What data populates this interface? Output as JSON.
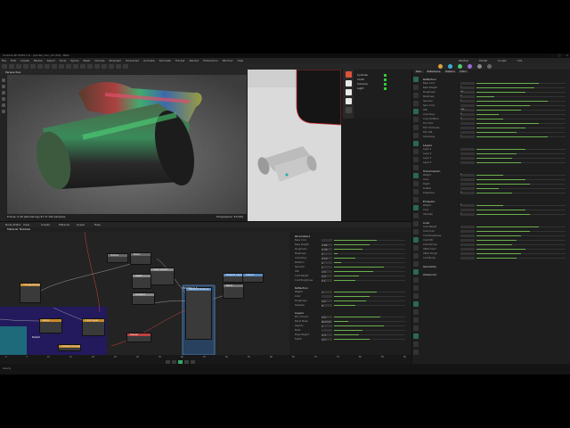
{
  "window": {
    "title": "Cinema 4D 2025.1.0 - [render_mix_v3.c4d] - Main"
  },
  "menubar": {
    "items": [
      "File",
      "Edit",
      "Create",
      "Modes",
      "Select",
      "Tools",
      "Spline",
      "Mesh",
      "Volume",
      "MoGraph",
      "Character",
      "Animate",
      "Simulate",
      "Tracker",
      "Render",
      "Extensions",
      "Window",
      "Help"
    ],
    "layout_tabs": [
      "Startup",
      "Model",
      "Sculpt",
      "UVs"
    ]
  },
  "viewport_main": {
    "header": "Perspective",
    "status_left": "Frame: 0 06 (Rendering) 97 of 100 samples",
    "status_right": "Progressive: 97/100"
  },
  "object_manager": {
    "rows": [
      "Cylinder",
      "Cloth",
      "Camera",
      "Light"
    ]
  },
  "node_editor": {
    "header_tabs": [
      "Node Editor",
      "View",
      "Create",
      "Material",
      "Graph",
      "Help"
    ],
    "tab": "Material: Bubbles",
    "nodes": [
      {
        "title": "Change Range"
      },
      {
        "title": "Texture"
      },
      {
        "title": "Noise"
      },
      {
        "title": "Color Correct"
      },
      {
        "title": "Invert"
      },
      {
        "title": "Material Layer"
      },
      {
        "title": "Output"
      },
      {
        "title": "Blend"
      },
      {
        "title": "Standard Material"
      },
      {
        "title": "Gradient"
      },
      {
        "title": "Color Layer"
      },
      {
        "title": "Ramp"
      },
      {
        "title": "Fresnel"
      },
      {
        "title": "Ambient Occlusion"
      }
    ],
    "frame_label": "MATERIALS",
    "material_label": "Standard Material",
    "area_label": "Detail"
  },
  "node_attributes": {
    "section1": "Parameters",
    "rows": [
      {
        "label": "Base Color",
        "val": "",
        "fill": 0.6
      },
      {
        "label": "Base Weight",
        "val": "0.82",
        "fill": 0.5
      },
      {
        "label": "Roughness",
        "val": "0.35",
        "fill": 0.4
      },
      {
        "label": "Metalness",
        "val": "0",
        "fill": 0.05
      },
      {
        "label": "Anisotropy",
        "val": "0.12",
        "fill": 0.3
      },
      {
        "label": "Rotation",
        "val": "0",
        "fill": 0.1
      },
      {
        "label": "Specular",
        "val": "1",
        "fill": 0.7
      },
      {
        "label": "IOR",
        "val": "1.5",
        "fill": 0.55
      },
      {
        "label": "Coat Weight",
        "val": "0.2",
        "fill": 0.35
      },
      {
        "label": "Coat Roughness",
        "val": "0.1",
        "fill": 0.3
      }
    ],
    "section2": "Reflection",
    "rows2": [
      {
        "label": "Weight",
        "val": "1",
        "fill": 0.6
      },
      {
        "label": "Color",
        "val": "",
        "fill": 0.5
      },
      {
        "label": "Roughness",
        "val": "0.2",
        "fill": 0.45
      },
      {
        "label": "Samples",
        "val": "8",
        "fill": 0.3
      }
    ],
    "section3": "Layers",
    "rows3": [
      {
        "label": "Mix Amount",
        "val": "0.5",
        "fill": 0.65
      },
      {
        "label": "Blend Mode",
        "val": "Normal",
        "fill": 0.2
      },
      {
        "label": "Opacity",
        "val": "1",
        "fill": 0.7
      },
      {
        "label": "Mask",
        "val": "",
        "fill": 0.4
      },
      {
        "label": "Edge Weight",
        "val": "0.3",
        "fill": 0.35
      },
      {
        "label": "Falloff",
        "val": "0.7",
        "fill": 0.5
      }
    ]
  },
  "timeline": {
    "ticks": [
      "0",
      "5",
      "10",
      "15",
      "20",
      "25",
      "30",
      "35",
      "40",
      "45",
      "50",
      "55",
      "60",
      "65",
      "70",
      "75",
      "80",
      "85",
      "90"
    ]
  },
  "attribute_manager": {
    "tabs": [
      "Basic",
      "Reflectance",
      "Material",
      "Editor"
    ],
    "sections": [
      {
        "title": "Reflection",
        "rows": [
          {
            "label": "Base Color",
            "val": "",
            "fill": 0.7
          },
          {
            "label": "Base Weight",
            "val": "1",
            "fill": 0.65
          },
          {
            "label": "Roughness",
            "val": "0.3",
            "fill": 0.55
          },
          {
            "label": "Metalness",
            "val": "0",
            "fill": 0.2
          },
          {
            "label": "Specular",
            "val": "1",
            "fill": 0.8
          },
          {
            "label": "Spec Color",
            "val": "",
            "fill": 0.6
          },
          {
            "label": "IOR",
            "val": "1.45",
            "fill": 0.5
          },
          {
            "label": "Anisotropy",
            "val": "0",
            "fill": 0.25
          },
          {
            "label": "Aniso Rotation",
            "val": "0",
            "fill": 0.3
          },
          {
            "label": "Thin Film",
            "val": "",
            "fill": 0.7
          },
          {
            "label": "Film Thickness",
            "val": "",
            "fill": 0.55
          },
          {
            "label": "Film IOR",
            "val": "",
            "fill": 0.45
          },
          {
            "label": "Glossiness",
            "val": "1",
            "fill": 0.8
          }
        ]
      },
      {
        "title": "Layers",
        "rows": [
          {
            "label": "Layer 1",
            "val": "",
            "fill": 0.55
          },
          {
            "label": "Layer 2",
            "val": "",
            "fill": 0.45
          },
          {
            "label": "Layer 3",
            "val": "",
            "fill": 0.4
          },
          {
            "label": "Layer 4",
            "val": "",
            "fill": 0.5
          }
        ]
      },
      {
        "title": "Transmission",
        "rows": [
          {
            "label": "Weight",
            "val": "0",
            "fill": 0.3
          },
          {
            "label": "Color",
            "val": "",
            "fill": 0.55
          },
          {
            "label": "Depth",
            "val": "",
            "fill": 0.6
          },
          {
            "label": "Scatter",
            "val": "",
            "fill": 0.25
          },
          {
            "label": "Dispersion",
            "val": "0",
            "fill": 0.4
          }
        ]
      },
      {
        "title": "Emission",
        "rows": [
          {
            "label": "Weight",
            "val": "0",
            "fill": 0.3
          },
          {
            "label": "Color",
            "val": "",
            "fill": 0.55
          },
          {
            "label": "Intensity",
            "val": "1",
            "fill": 0.6
          }
        ]
      },
      {
        "title": "Coat",
        "rows": [
          {
            "label": "Coat Weight",
            "val": "",
            "fill": 0.7
          },
          {
            "label": "Coat Color",
            "val": "",
            "fill": 0.6
          },
          {
            "label": "Coat Roughness",
            "val": "",
            "fill": 0.5
          },
          {
            "label": "Coat IOR",
            "val": "",
            "fill": 0.45
          },
          {
            "label": "Coat Normal",
            "val": "",
            "fill": 0.4
          },
          {
            "label": "Affect Color",
            "val": "",
            "fill": 0.55
          },
          {
            "label": "Affect Rough",
            "val": "",
            "fill": 0.5
          },
          {
            "label": "Coat Bump",
            "val": "",
            "fill": 0.45
          }
        ]
      },
      {
        "title": "Geometry",
        "rows": []
      },
      {
        "title": "Advanced",
        "rows": []
      }
    ]
  },
  "statusbar": {
    "text": "Ready"
  },
  "colors": {
    "accent": "#6ab04c",
    "selection": "#3b6fd1",
    "frame": "#5b8cc4",
    "red": "#d9533b",
    "purple": "#2a1a66"
  }
}
